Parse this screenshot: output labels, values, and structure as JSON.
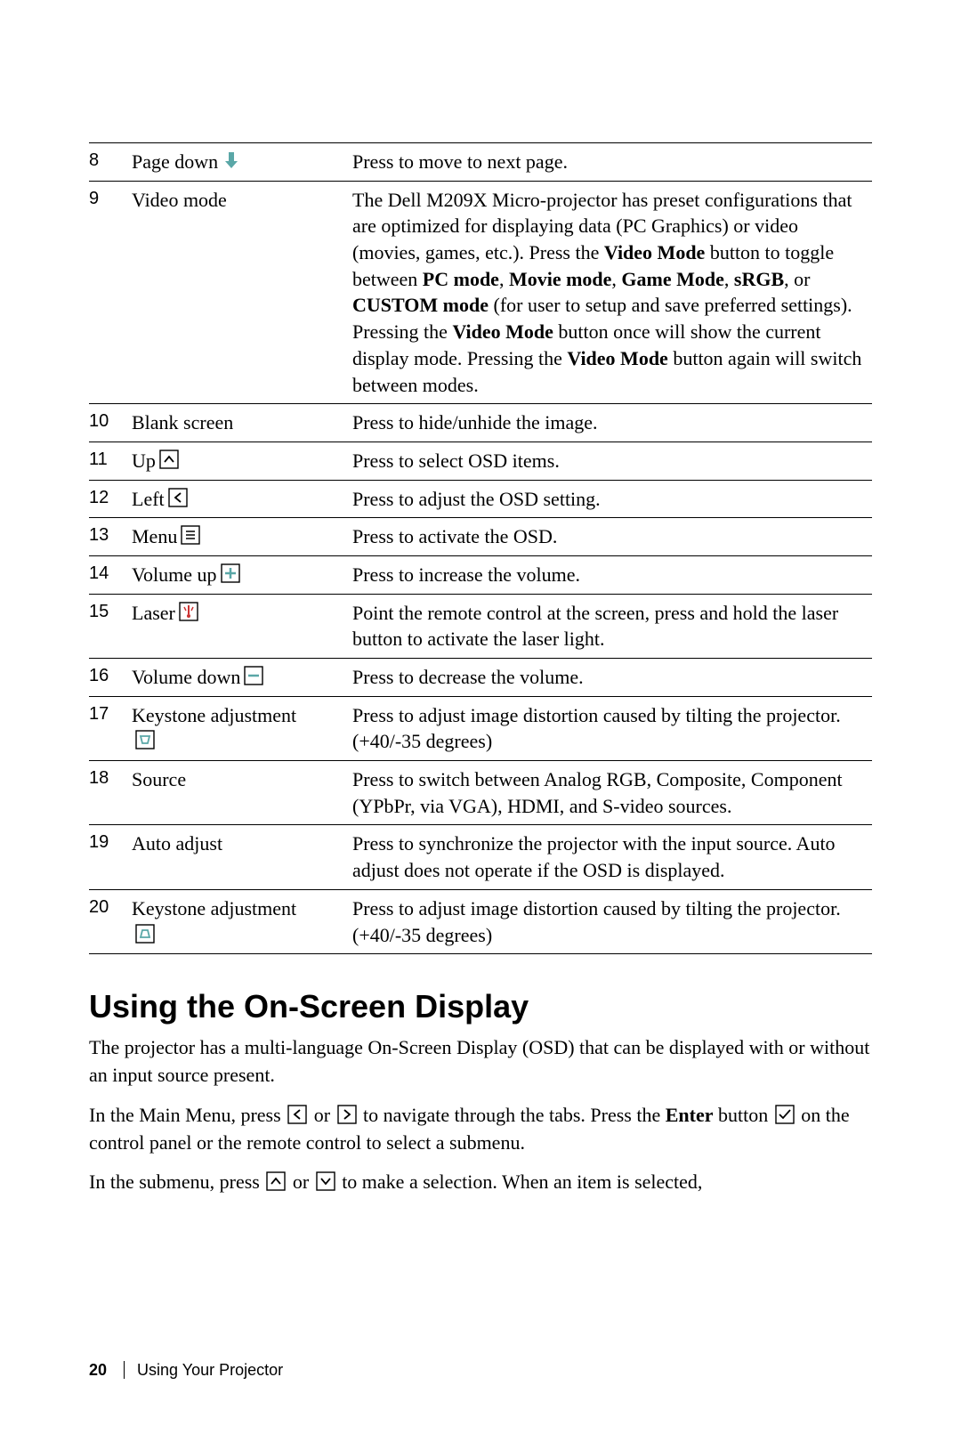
{
  "rows": [
    {
      "num": "8",
      "name": "Page down",
      "icon": "arrow-down-teal",
      "desc_html": "Press to move to next page."
    },
    {
      "num": "9",
      "name": "Video mode",
      "icon": "",
      "desc_html": "The Dell M209X Micro-projector has preset configurations that are optimized for displaying data (PC Graphics) or video (movies, games, etc.). Press the <b>Video Mode</b> button to toggle between <b>PC mode</b>, <b>Movie mode</b>, <b>Game Mode</b>, <b>sRGB</b>, or <b>CUSTOM mode</b> (for user to setup and save preferred settings). Pressing the <b>Video Mode</b> button once will show the current display mode. Pressing the <b>Video Mode</b> button again will switch between modes."
    },
    {
      "num": "10",
      "name": "Blank screen",
      "icon": "",
      "desc_html": "Press to hide/unhide the image."
    },
    {
      "num": "11",
      "name": "Up",
      "icon": "box-up",
      "desc_html": "Press to select OSD items."
    },
    {
      "num": "12",
      "name": "Left",
      "icon": "box-left",
      "desc_html": "Press to adjust the OSD setting."
    },
    {
      "num": "13",
      "name": "Menu",
      "icon": "box-menu",
      "desc_html": "Press to activate the OSD."
    },
    {
      "num": "14",
      "name": "Volume up",
      "icon": "box-plus",
      "desc_html": "Press to increase the volume."
    },
    {
      "num": "15",
      "name": "Laser",
      "icon": "box-laser",
      "desc_html": "Point the remote control at the screen, press and hold the laser button to activate the laser light."
    },
    {
      "num": "16",
      "name": "Volume down",
      "icon": "box-minus",
      "desc_html": "Press to decrease the volume."
    },
    {
      "num": "17",
      "name": "Keystone adjustment",
      "icon": "box-keystone-down",
      "name_break": true,
      "desc_html": "Press to adjust image distortion caused by tilting the projector. (+40/-35 degrees)"
    },
    {
      "num": "18",
      "name": "Source",
      "icon": "",
      "desc_html": "Press to switch between Analog RGB, Composite, Component (YPbPr, via VGA), HDMI, and S-video sources."
    },
    {
      "num": "19",
      "name": "Auto adjust",
      "icon": "",
      "desc_html": "Press to synchronize the projector with the input source. Auto adjust does not operate if the OSD is displayed."
    },
    {
      "num": "20",
      "name": "Keystone adjustment",
      "icon": "box-keystone-up",
      "name_break": true,
      "desc_html": "Press to adjust image distortion caused by tilting the projector. (+40/-35 degrees)"
    }
  ],
  "heading": "Using the On-Screen Display",
  "para1": "The projector has a multi-language On-Screen Display (OSD) that can be displayed with or without an input source present.",
  "para2_parts": {
    "a": "In the Main Menu, press ",
    "b": " or ",
    "c": " to navigate through the tabs. Press the ",
    "enter": "Enter",
    "d": " button ",
    "e": " on the control panel or the remote control to select a submenu."
  },
  "para3_parts": {
    "a": "In the submenu, press ",
    "b": " or ",
    "c": " to make a selection. When an item is selected,"
  },
  "footer": {
    "page": "20",
    "section": "Using Your Projector"
  }
}
